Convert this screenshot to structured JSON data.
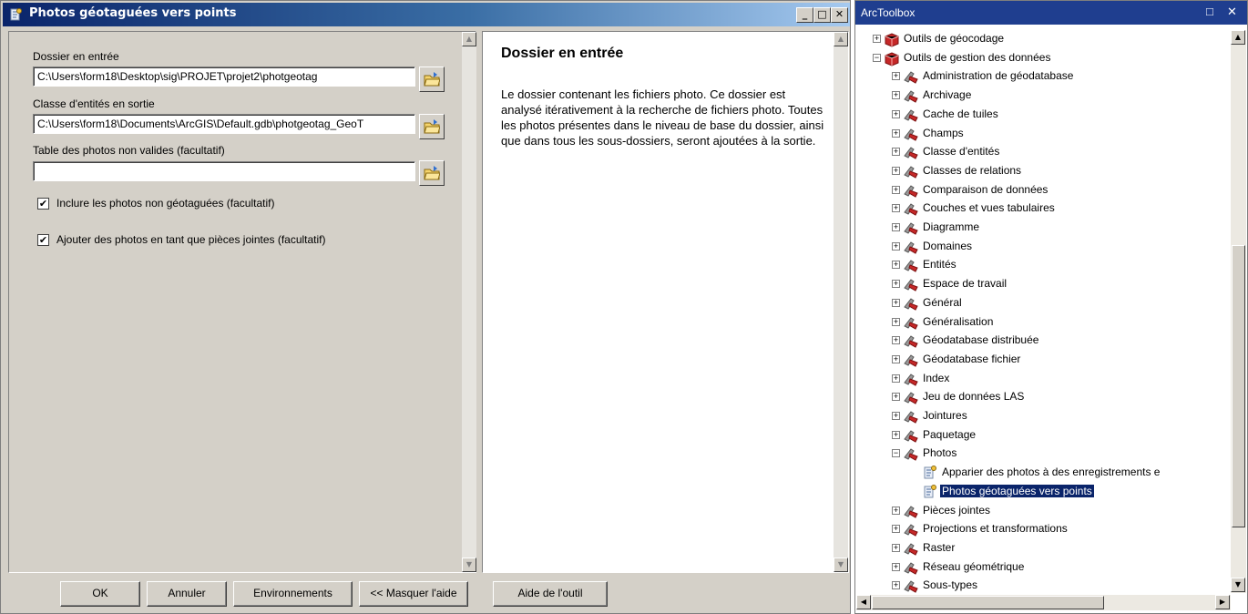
{
  "dialog": {
    "title": "Photos géotaguées vers points",
    "window_buttons": {
      "minimize": "_",
      "maximize": "□",
      "close": "✕"
    },
    "params": {
      "input_folder_label": "Dossier en entrée",
      "input_folder_value": "C:\\Users\\form18\\Desktop\\sig\\PROJET\\projet2\\photgeotag",
      "output_fc_label": "Classe d'entités en sortie",
      "output_fc_value": "C:\\Users\\form18\\Documents\\ArcGIS\\Default.gdb\\photgeotag_GeoT",
      "invalid_table_label": "Table des photos non valides (facultatif)",
      "invalid_table_value": "",
      "include_nongeotagged_label": "Inclure les photos non géotaguées (facultatif)",
      "include_nongeotagged_checked": true,
      "add_attachments_label": "Ajouter des photos en tant que pièces jointes (facultatif)",
      "add_attachments_checked": true
    },
    "help": {
      "title": "Dossier en entrée",
      "body": "Le dossier contenant les fichiers photo. Ce dossier est analysé itérativement à la recherche de fichiers photo. Toutes les photos présentes dans le niveau de base du dossier, ainsi que dans tous les sous-dossiers, seront ajoutées à la sortie."
    },
    "buttons": {
      "ok": "OK",
      "cancel": "Annuler",
      "environments": "Environnements",
      "hide_help": "<< Masquer l'aide",
      "tool_help": "Aide de l'outil"
    }
  },
  "toolbox": {
    "title": "ArcToolbox",
    "tree": [
      {
        "label": "Outils de géocodage",
        "level": 0,
        "expander": "+",
        "icon": "toolbox-icon"
      },
      {
        "label": "Outils de gestion des données",
        "level": 0,
        "expander": "−",
        "icon": "toolbox-icon"
      },
      {
        "label": "Administration de géodatabase",
        "level": 1,
        "expander": "+",
        "icon": "toolset-icon"
      },
      {
        "label": "Archivage",
        "level": 1,
        "expander": "+",
        "icon": "toolset-icon"
      },
      {
        "label": "Cache de tuiles",
        "level": 1,
        "expander": "+",
        "icon": "toolset-icon"
      },
      {
        "label": "Champs",
        "level": 1,
        "expander": "+",
        "icon": "toolset-icon"
      },
      {
        "label": "Classe d'entités",
        "level": 1,
        "expander": "+",
        "icon": "toolset-icon"
      },
      {
        "label": "Classes de relations",
        "level": 1,
        "expander": "+",
        "icon": "toolset-icon"
      },
      {
        "label": "Comparaison de données",
        "level": 1,
        "expander": "+",
        "icon": "toolset-icon"
      },
      {
        "label": "Couches et vues tabulaires",
        "level": 1,
        "expander": "+",
        "icon": "toolset-icon"
      },
      {
        "label": "Diagramme",
        "level": 1,
        "expander": "+",
        "icon": "toolset-icon"
      },
      {
        "label": "Domaines",
        "level": 1,
        "expander": "+",
        "icon": "toolset-icon"
      },
      {
        "label": "Entités",
        "level": 1,
        "expander": "+",
        "icon": "toolset-icon"
      },
      {
        "label": "Espace de travail",
        "level": 1,
        "expander": "+",
        "icon": "toolset-icon"
      },
      {
        "label": "Général",
        "level": 1,
        "expander": "+",
        "icon": "toolset-icon"
      },
      {
        "label": "Généralisation",
        "level": 1,
        "expander": "+",
        "icon": "toolset-icon"
      },
      {
        "label": "Géodatabase distribuée",
        "level": 1,
        "expander": "+",
        "icon": "toolset-icon"
      },
      {
        "label": "Géodatabase fichier",
        "level": 1,
        "expander": "+",
        "icon": "toolset-icon"
      },
      {
        "label": "Index",
        "level": 1,
        "expander": "+",
        "icon": "toolset-icon"
      },
      {
        "label": "Jeu de données LAS",
        "level": 1,
        "expander": "+",
        "icon": "toolset-icon"
      },
      {
        "label": "Jointures",
        "level": 1,
        "expander": "+",
        "icon": "toolset-icon"
      },
      {
        "label": "Paquetage",
        "level": 1,
        "expander": "+",
        "icon": "toolset-icon"
      },
      {
        "label": "Photos",
        "level": 1,
        "expander": "−",
        "icon": "toolset-icon"
      },
      {
        "label": "Apparier des photos à des enregistrements e",
        "level": 2,
        "expander": "",
        "icon": "script-tool-icon"
      },
      {
        "label": "Photos géotaguées vers points",
        "level": 2,
        "expander": "",
        "icon": "script-tool-icon",
        "selected": true
      },
      {
        "label": "Pièces jointes",
        "level": 1,
        "expander": "+",
        "icon": "toolset-icon"
      },
      {
        "label": "Projections et transformations",
        "level": 1,
        "expander": "+",
        "icon": "toolset-icon"
      },
      {
        "label": "Raster",
        "level": 1,
        "expander": "+",
        "icon": "toolset-icon"
      },
      {
        "label": "Réseau géométrique",
        "level": 1,
        "expander": "+",
        "icon": "toolset-icon"
      },
      {
        "label": "Sous-types",
        "level": 1,
        "expander": "+",
        "icon": "toolset-icon"
      }
    ]
  }
}
